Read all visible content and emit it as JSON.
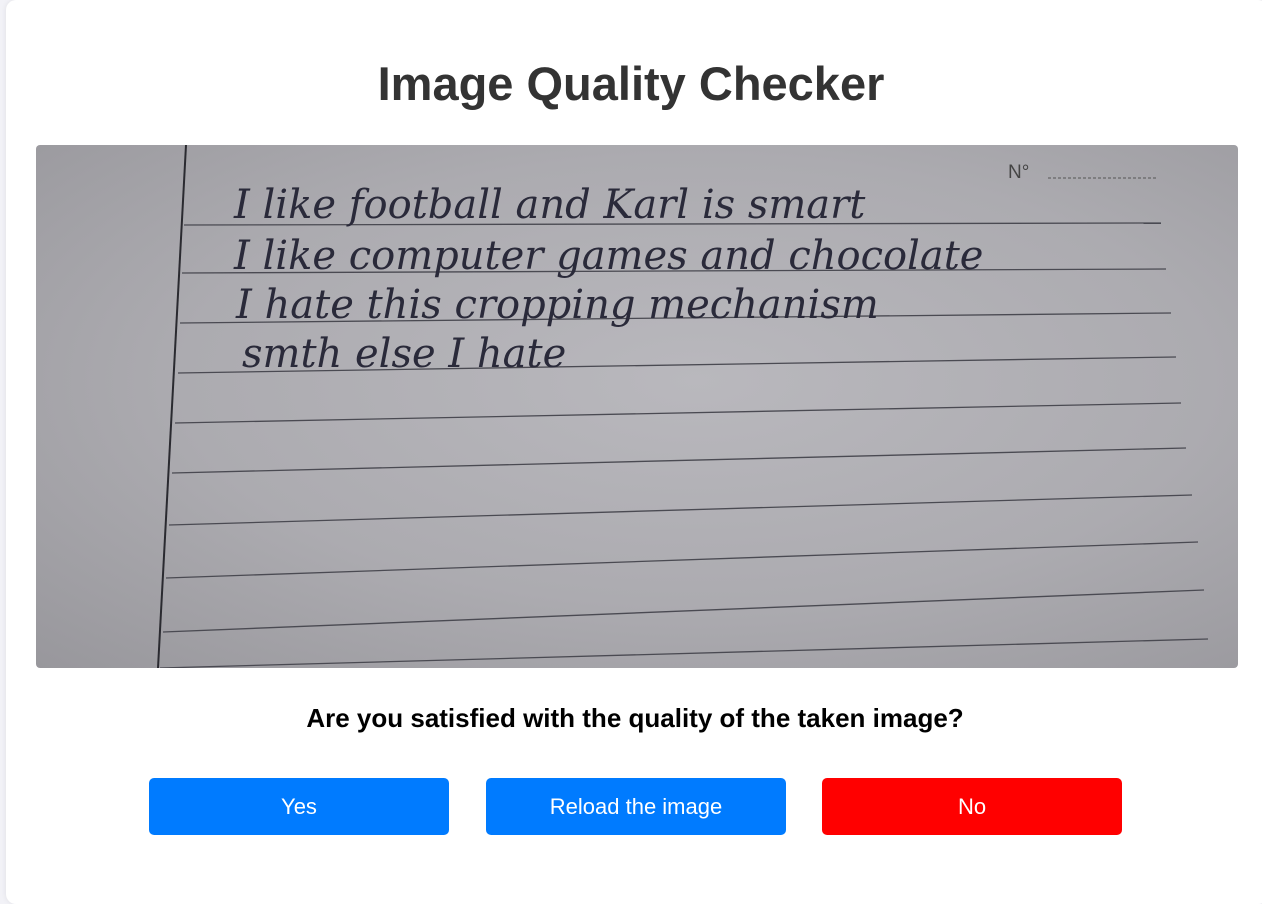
{
  "page": {
    "title": "Image Quality Checker",
    "question": "Are you satisfied with the quality of the taken image?"
  },
  "photo": {
    "page_number_label": "N°",
    "handwritten_lines": [
      "I like football and Karl is smart",
      "I like computer games and chocolate",
      "I hate this cropping mechanism",
      "smth else I hate"
    ]
  },
  "buttons": {
    "yes_label": "Yes",
    "reload_label": "Reload the image",
    "no_label": "No"
  },
  "colors": {
    "primary": "#007bff",
    "danger": "#ff0000",
    "title": "#333333"
  }
}
